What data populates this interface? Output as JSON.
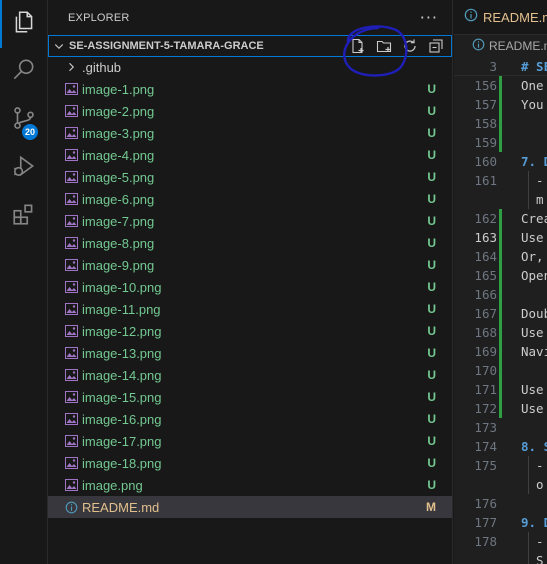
{
  "activity_bar": {
    "items": [
      {
        "name": "explorer",
        "icon": "files-icon",
        "active": true
      },
      {
        "name": "search",
        "icon": "search-icon",
        "active": false
      },
      {
        "name": "source-control",
        "icon": "source-control-icon",
        "active": false,
        "badge": "20"
      },
      {
        "name": "run-debug",
        "icon": "run-debug-icon",
        "active": false
      },
      {
        "name": "extensions",
        "icon": "extensions-icon",
        "active": false
      }
    ]
  },
  "explorer": {
    "title": "EXPLORER",
    "more_label": "···",
    "section_title": "SE-ASSIGNMENT-5-TAMARA-GRACE",
    "section_actions": [
      "new-file-icon",
      "new-folder-icon",
      "refresh-icon",
      "collapse-all-icon"
    ],
    "files": [
      {
        "name": ".github",
        "type": "folder",
        "status": ""
      },
      {
        "name": "image-1.png",
        "type": "image",
        "status": "U"
      },
      {
        "name": "image-2.png",
        "type": "image",
        "status": "U"
      },
      {
        "name": "image-3.png",
        "type": "image",
        "status": "U"
      },
      {
        "name": "image-4.png",
        "type": "image",
        "status": "U"
      },
      {
        "name": "image-5.png",
        "type": "image",
        "status": "U"
      },
      {
        "name": "image-6.png",
        "type": "image",
        "status": "U"
      },
      {
        "name": "image-7.png",
        "type": "image",
        "status": "U"
      },
      {
        "name": "image-8.png",
        "type": "image",
        "status": "U"
      },
      {
        "name": "image-9.png",
        "type": "image",
        "status": "U"
      },
      {
        "name": "image-10.png",
        "type": "image",
        "status": "U"
      },
      {
        "name": "image-11.png",
        "type": "image",
        "status": "U"
      },
      {
        "name": "image-12.png",
        "type": "image",
        "status": "U"
      },
      {
        "name": "image-13.png",
        "type": "image",
        "status": "U"
      },
      {
        "name": "image-14.png",
        "type": "image",
        "status": "U"
      },
      {
        "name": "image-15.png",
        "type": "image",
        "status": "U"
      },
      {
        "name": "image-16.png",
        "type": "image",
        "status": "U"
      },
      {
        "name": "image-17.png",
        "type": "image",
        "status": "U"
      },
      {
        "name": "image-18.png",
        "type": "image",
        "status": "U"
      },
      {
        "name": "image.png",
        "type": "image",
        "status": "U"
      },
      {
        "name": "README.md",
        "type": "info",
        "status": "M",
        "selected": true
      }
    ]
  },
  "editor": {
    "tab_label": "README.md",
    "breadcrumb_label": "README.m",
    "sticky_line": {
      "num": "3",
      "code": "# SE"
    },
    "lines": [
      {
        "num": "156",
        "code": "One ",
        "git": true
      },
      {
        "num": "157",
        "code": "You ",
        "git": true
      },
      {
        "num": "158",
        "code": "",
        "git": true
      },
      {
        "num": "159",
        "code": "",
        "git": true
      },
      {
        "num": "160",
        "code": "7. D",
        "git": false,
        "heading": true
      },
      {
        "num": "161",
        "code": "  -",
        "git": false,
        "guide": true
      },
      {
        "num": "",
        "code": "  m",
        "git": false,
        "guide": true
      },
      {
        "num": "162",
        "code": "Crea",
        "git": true
      },
      {
        "num": "163",
        "code": "Use ",
        "git": true,
        "current": true
      },
      {
        "num": "164",
        "code": "Or, ",
        "git": true
      },
      {
        "num": "165",
        "code": "Open",
        "git": true
      },
      {
        "num": "166",
        "code": "",
        "git": true
      },
      {
        "num": "167",
        "code": "Doub",
        "git": true
      },
      {
        "num": "168",
        "code": "Use ",
        "git": true
      },
      {
        "num": "169",
        "code": "Navi",
        "git": true
      },
      {
        "num": "170",
        "code": "",
        "git": true
      },
      {
        "num": "171",
        "code": "Use ",
        "git": true
      },
      {
        "num": "172",
        "code": "Use ",
        "git": true
      },
      {
        "num": "173",
        "code": "",
        "git": false
      },
      {
        "num": "174",
        "code": "8. S",
        "git": false,
        "heading": true
      },
      {
        "num": "175",
        "code": "  -",
        "git": false,
        "guide": true
      },
      {
        "num": "",
        "code": "  o",
        "git": false,
        "guide": true
      },
      {
        "num": "176",
        "code": "",
        "git": false
      },
      {
        "num": "177",
        "code": "9. D",
        "git": false,
        "heading": true
      },
      {
        "num": "178",
        "code": "  -",
        "git": false,
        "guide": true
      },
      {
        "num": "",
        "code": "  S",
        "git": false,
        "guide": true
      }
    ]
  },
  "colors": {
    "accent": "#0078d4",
    "untracked": "#73c991",
    "modified": "#e2c08d",
    "annotation_ink": "#1f1fb8"
  }
}
